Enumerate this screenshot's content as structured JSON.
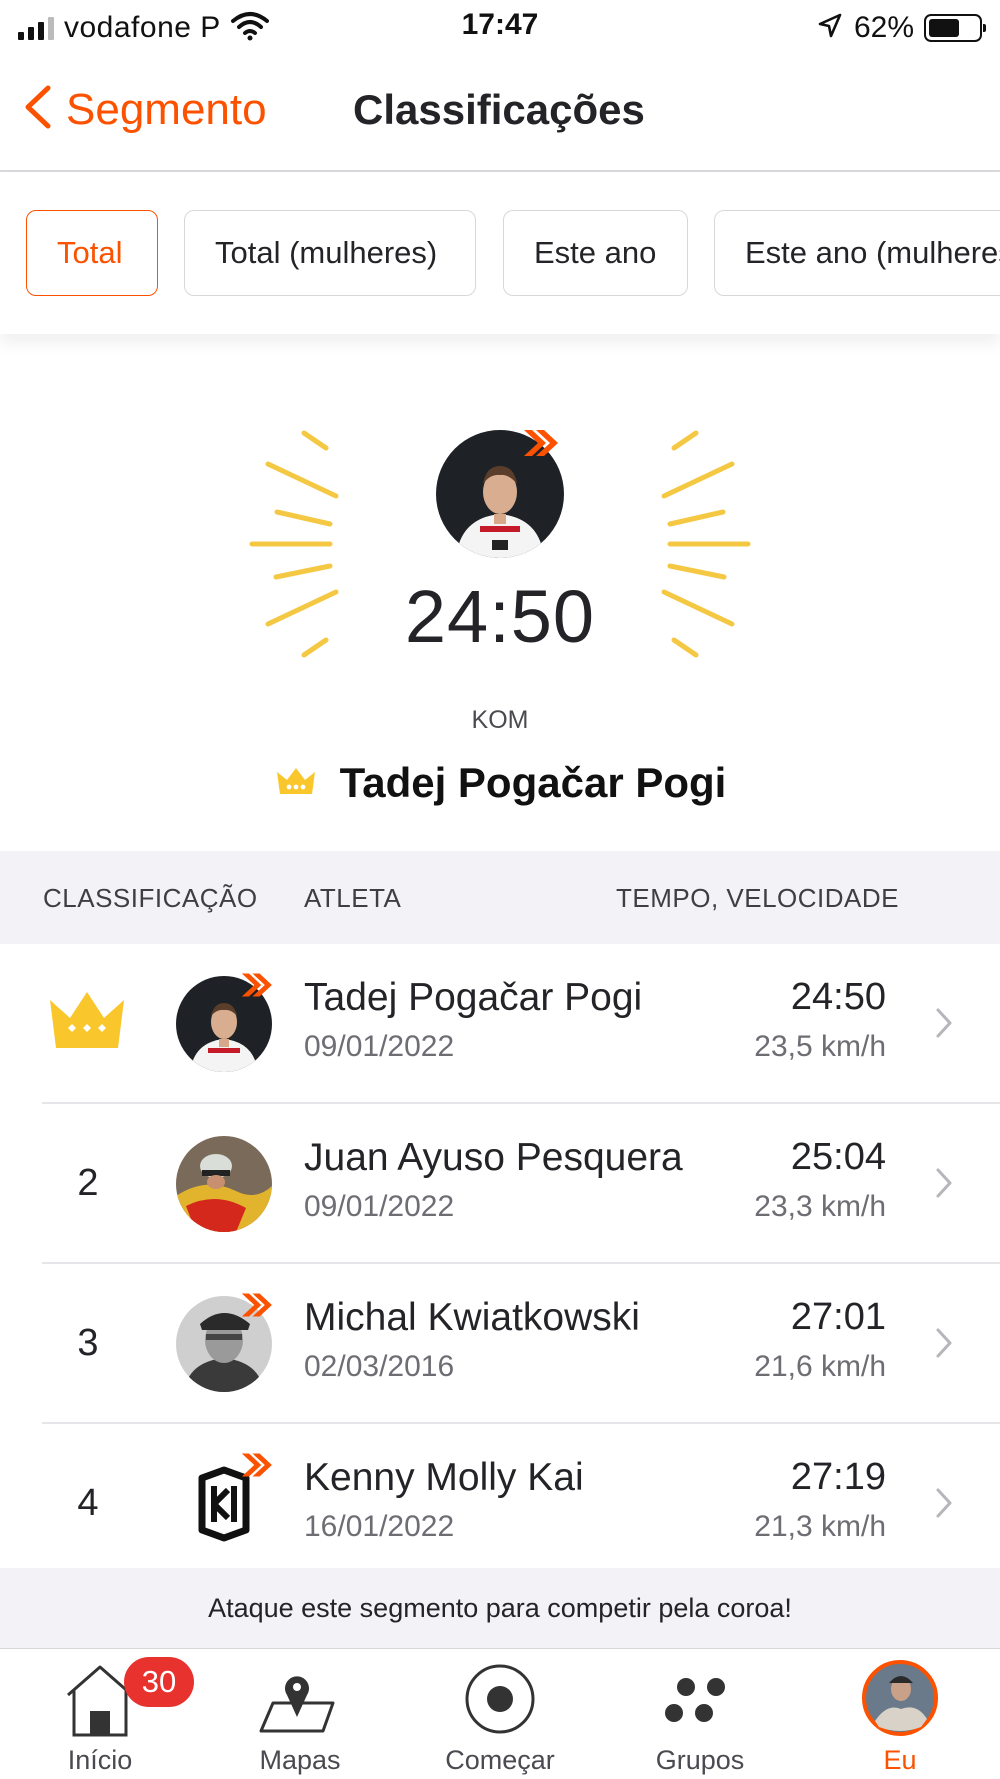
{
  "status_bar": {
    "carrier": "vodafone P",
    "time": "17:47",
    "battery": "62%",
    "battery_level": 0.62
  },
  "nav": {
    "back_label": "Segmento",
    "title": "Classificações"
  },
  "filters": [
    {
      "label": "Total",
      "active": true
    },
    {
      "label": "Total (mulheres)",
      "active": false
    },
    {
      "label": "Este ano",
      "active": false
    },
    {
      "label": "Este ano (mulheres)",
      "active": false
    }
  ],
  "hero": {
    "time": "24:50",
    "label": "KOM",
    "name": "Tadej Pogačar Pogi"
  },
  "table": {
    "headers": {
      "rank": "CLASSIFICAÇÃO",
      "athlete": "ATLETA",
      "time_speed": "TEMPO, VELOCIDADE"
    },
    "rows": [
      {
        "rank": "",
        "name": "Tadej Pogačar Pogi",
        "date": "09/01/2022",
        "time": "24:50",
        "speed": "23,5 km/h"
      },
      {
        "rank": "2",
        "name": "Juan Ayuso Pesquera",
        "date": "09/01/2022",
        "time": "25:04",
        "speed": "23,3 km/h"
      },
      {
        "rank": "3",
        "name": "Michal Kwiatkowski",
        "date": "02/03/2016",
        "time": "27:01",
        "speed": "21,6 km/h"
      },
      {
        "rank": "4",
        "name": "Kenny Molly Kai",
        "date": "16/01/2022",
        "time": "27:19",
        "speed": "21,3 km/h"
      }
    ]
  },
  "banner": "Ataque este segmento para competir pela coroa!",
  "tabs": [
    {
      "label": "Início",
      "badge": "30"
    },
    {
      "label": "Mapas"
    },
    {
      "label": "Começar"
    },
    {
      "label": "Grupos"
    },
    {
      "label": "Eu",
      "active": true
    }
  ],
  "colors": {
    "accent": "#fc5200",
    "crown": "#f9c62b",
    "rays": "#f5c843",
    "badge": "#e8322e"
  }
}
